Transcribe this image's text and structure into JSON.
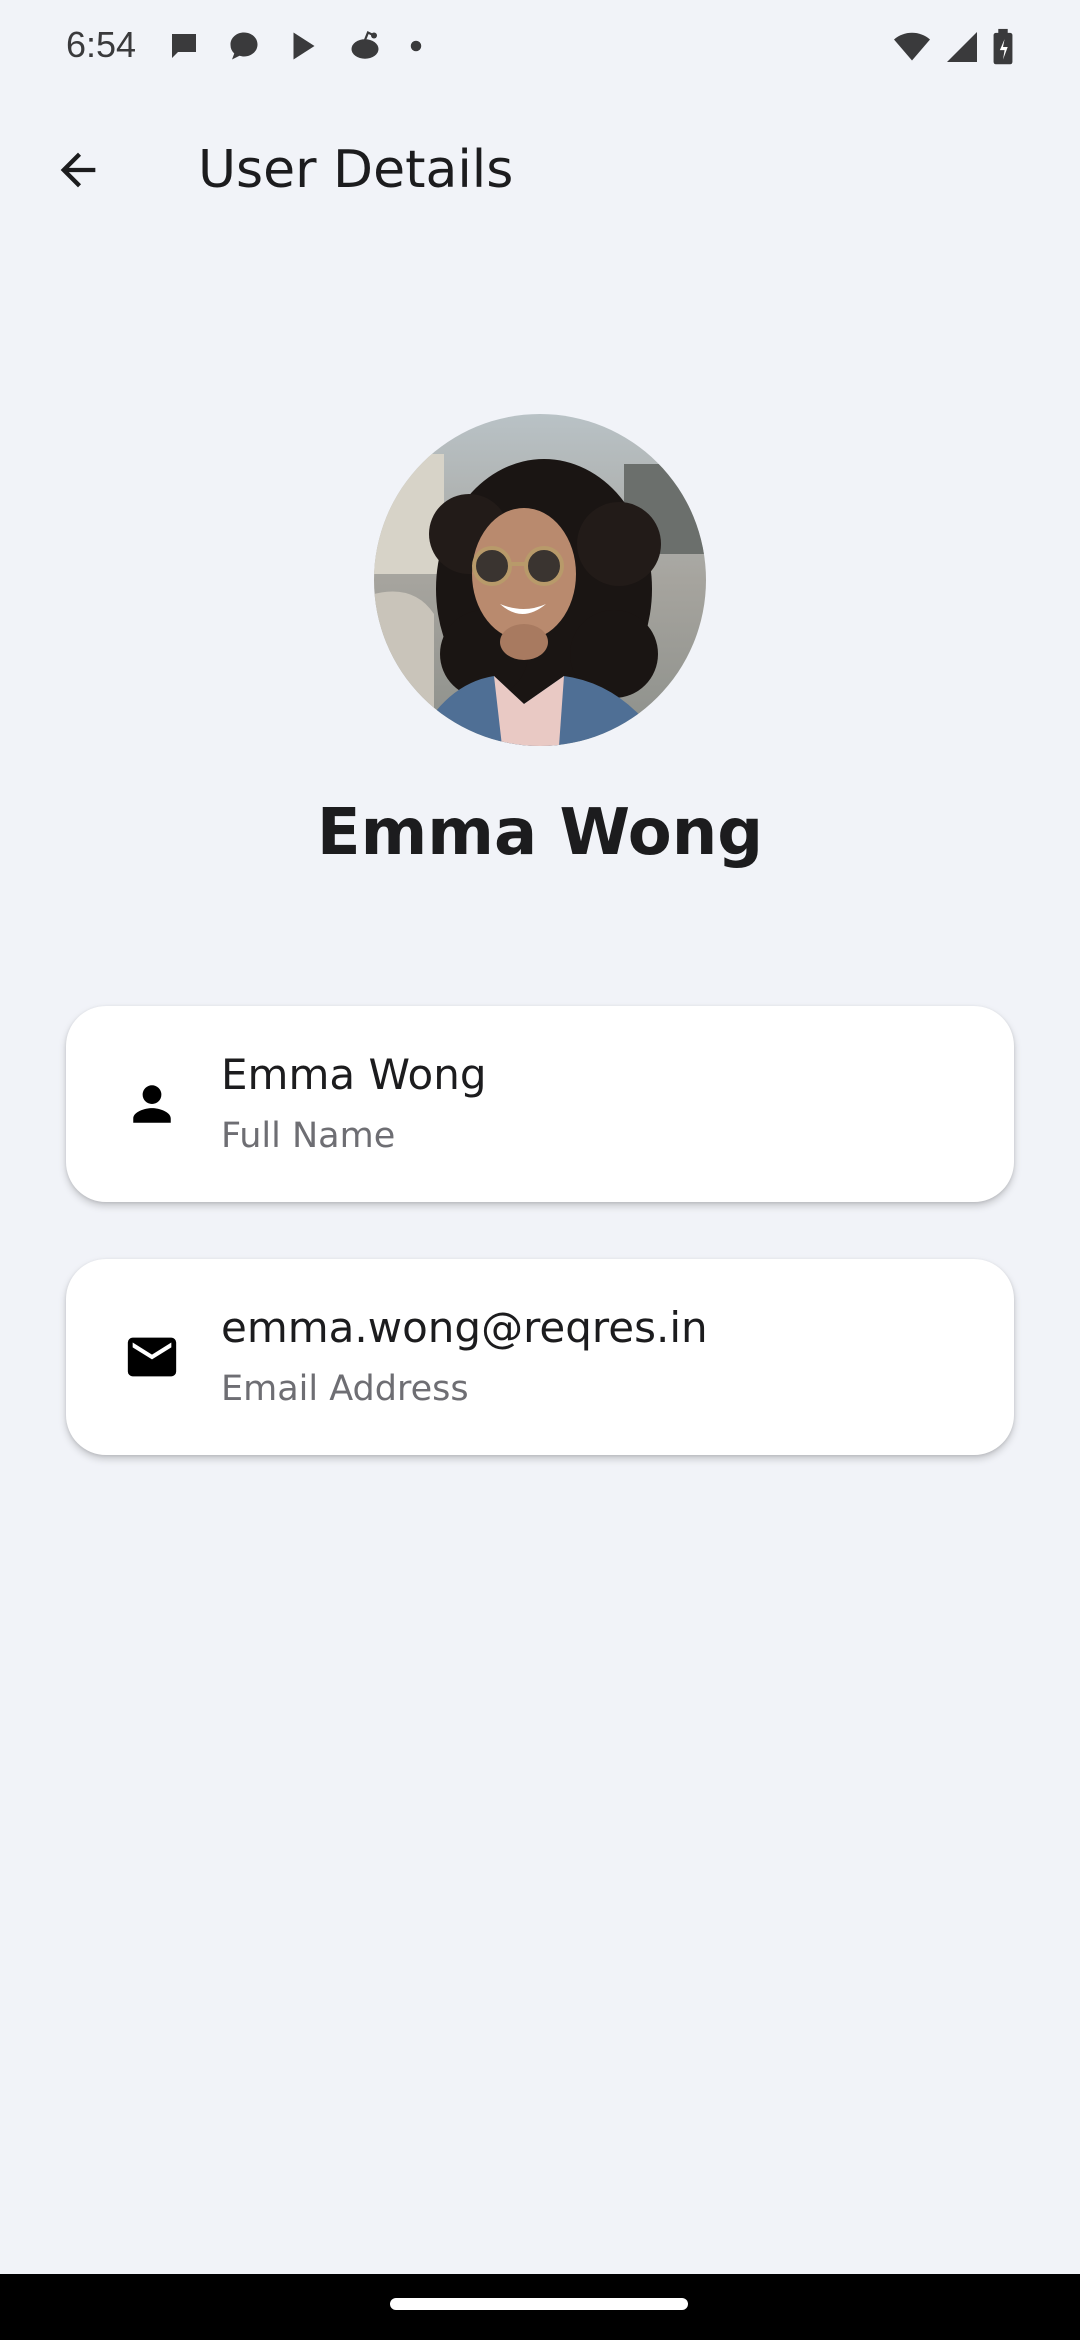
{
  "status_bar": {
    "time": "6:54",
    "notification_icons": [
      "chat-bubble-icon",
      "chat-bubble-icon",
      "play-store-icon",
      "reddit-icon",
      "dot-icon"
    ],
    "system_icons": [
      "wifi-icon",
      "cell-signal-icon",
      "battery-charging-icon"
    ]
  },
  "app_bar": {
    "title": "User Details",
    "back_icon": "arrow-back-icon"
  },
  "profile": {
    "name": "Emma Wong"
  },
  "details": [
    {
      "value": "Emma Wong",
      "label": "Full Name",
      "icon": "person-icon"
    },
    {
      "value": "emma.wong@reqres.in",
      "label": "Email Address",
      "icon": "mail-icon"
    }
  ],
  "colors": {
    "background": "#f1f3f8",
    "card": "#ffffff",
    "text_primary": "#1c1c1e",
    "text_secondary": "#6e6e73"
  }
}
